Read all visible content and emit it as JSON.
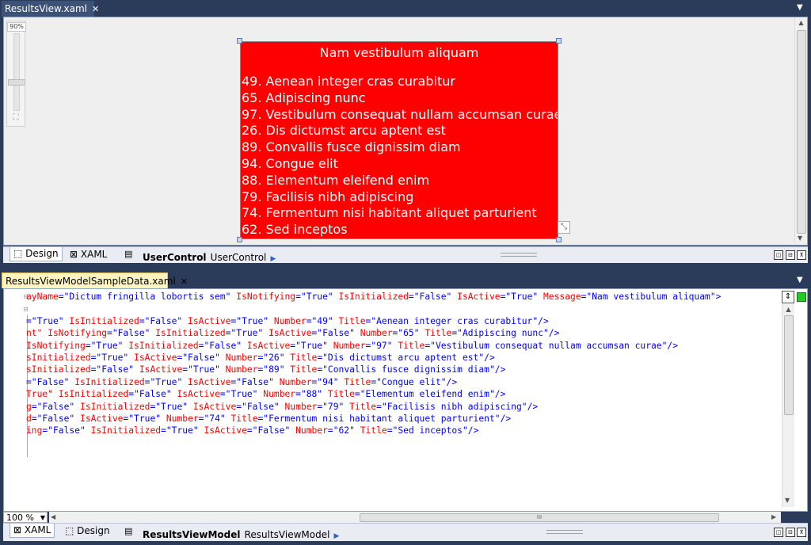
{
  "designer_tab": {
    "label": "ResultsView.xaml",
    "close": "✕"
  },
  "editor_tab": {
    "label": "ResultsViewModelSampleData.xaml",
    "close": "✕"
  },
  "zoom_slider_label": "90%",
  "preview": {
    "title": "Nam vestibulum aliquam",
    "items": [
      "49.  Aenean integer cras curabitur",
      "65.  Adipiscing nunc",
      "97.  Vestibulum consequat nullam accumsan curae",
      "26.  Dis dictumst arcu aptent est",
      "89.  Convallis fusce dignissim diam",
      "94.  Congue elit",
      "88.  Elementum eleifend enim",
      "79.  Facilisis nibh adipiscing",
      "74.  Fermentum nisi habitant aliquet parturient",
      "62.  Sed inceptos"
    ]
  },
  "designer_strip": {
    "design_tab": "Design",
    "xaml_tab": "XAML",
    "breadcrumb_bold": "UserControl",
    "breadcrumb": "UserControl"
  },
  "editor_strip": {
    "xaml_tab": "XAML",
    "design_tab": "Design",
    "breadcrumb_bold": "ResultsViewModel",
    "breadcrumb": "ResultsViewModel",
    "zoom": "100 %"
  },
  "code_lines": [
    [
      [
        "a",
        "ayName"
      ],
      [
        "v",
        "=\"Dictum fringilla lobortis sem\""
      ],
      [
        "a",
        " IsNotifying"
      ],
      [
        "v",
        "=\"True\""
      ],
      [
        "a",
        " IsInitialized"
      ],
      [
        "v",
        "=\"False\""
      ],
      [
        "a",
        " IsActive"
      ],
      [
        "v",
        "=\"True\""
      ],
      [
        "a",
        " Message"
      ],
      [
        "v",
        "=\"Nam vestibulum aliquam\""
      ],
      [
        "v",
        ">"
      ]
    ],
    [],
    [
      [
        "v",
        "=\"True\""
      ],
      [
        "a",
        " IsInitialized"
      ],
      [
        "v",
        "=\"False\""
      ],
      [
        "a",
        " IsActive"
      ],
      [
        "v",
        "=\"True\""
      ],
      [
        "a",
        " Number"
      ],
      [
        "v",
        "=\"49\""
      ],
      [
        "a",
        " Title"
      ],
      [
        "v",
        "=\"Aenean integer cras curabitur\""
      ],
      [
        "v",
        "/>"
      ]
    ],
    [
      [
        "a",
        "nt\""
      ],
      [
        "a",
        " IsNotifying"
      ],
      [
        "v",
        "=\"False\""
      ],
      [
        "a",
        " IsInitialized"
      ],
      [
        "v",
        "=\"True\""
      ],
      [
        "a",
        " IsActive"
      ],
      [
        "v",
        "=\"False\""
      ],
      [
        "a",
        " Number"
      ],
      [
        "v",
        "=\"65\""
      ],
      [
        "a",
        " Title"
      ],
      [
        "v",
        "=\"Adipiscing nunc\""
      ],
      [
        "v",
        "/>"
      ]
    ],
    [
      [
        "a",
        "IsNotifying"
      ],
      [
        "v",
        "=\"True\""
      ],
      [
        "a",
        " IsInitialized"
      ],
      [
        "v",
        "=\"False\""
      ],
      [
        "a",
        " IsActive"
      ],
      [
        "v",
        "=\"True\""
      ],
      [
        "a",
        " Number"
      ],
      [
        "v",
        "=\"97\""
      ],
      [
        "a",
        " Title"
      ],
      [
        "v",
        "=\"Vestibulum consequat nullam accumsan curae\""
      ],
      [
        "v",
        "/>"
      ]
    ],
    [
      [
        "a",
        "sInitialized"
      ],
      [
        "v",
        "=\"True\""
      ],
      [
        "a",
        " IsActive"
      ],
      [
        "v",
        "=\"False\""
      ],
      [
        "a",
        " Number"
      ],
      [
        "v",
        "=\"26\""
      ],
      [
        "a",
        " Title"
      ],
      [
        "v",
        "=\"Dis dictumst arcu aptent est\""
      ],
      [
        "v",
        "/>"
      ]
    ],
    [
      [
        "a",
        "sInitialized"
      ],
      [
        "v",
        "=\"False\""
      ],
      [
        "a",
        " IsActive"
      ],
      [
        "v",
        "=\"True\""
      ],
      [
        "a",
        " Number"
      ],
      [
        "v",
        "=\"89\""
      ],
      [
        "a",
        " Title"
      ],
      [
        "v",
        "=\"Convallis fusce dignissim diam\""
      ],
      [
        "v",
        "/>"
      ]
    ],
    [
      [
        "v",
        "=\"False\""
      ],
      [
        "a",
        " IsInitialized"
      ],
      [
        "v",
        "=\"True\""
      ],
      [
        "a",
        " IsActive"
      ],
      [
        "v",
        "=\"False\""
      ],
      [
        "a",
        " Number"
      ],
      [
        "v",
        "=\"94\""
      ],
      [
        "a",
        " Title"
      ],
      [
        "v",
        "=\"Congue elit\""
      ],
      [
        "v",
        "/>"
      ]
    ],
    [
      [
        "a",
        "True\""
      ],
      [
        "a",
        " IsInitialized"
      ],
      [
        "v",
        "=\"False\""
      ],
      [
        "a",
        " IsActive"
      ],
      [
        "v",
        "=\"True\""
      ],
      [
        "a",
        " Number"
      ],
      [
        "v",
        "=\"88\""
      ],
      [
        "a",
        " Title"
      ],
      [
        "v",
        "=\"Elementum eleifend enim\""
      ],
      [
        "v",
        "/>"
      ]
    ],
    [
      [
        "a",
        "g"
      ],
      [
        "v",
        "=\"False\""
      ],
      [
        "a",
        " IsInitialized"
      ],
      [
        "v",
        "=\"True\""
      ],
      [
        "a",
        " IsActive"
      ],
      [
        "v",
        "=\"False\""
      ],
      [
        "a",
        " Number"
      ],
      [
        "v",
        "=\"79\""
      ],
      [
        "a",
        " Title"
      ],
      [
        "v",
        "=\"Facilisis nibh adipiscing\""
      ],
      [
        "v",
        "/>"
      ]
    ],
    [
      [
        "a",
        "d"
      ],
      [
        "v",
        "=\"False\""
      ],
      [
        "a",
        " IsActive"
      ],
      [
        "v",
        "=\"True\""
      ],
      [
        "a",
        " Number"
      ],
      [
        "v",
        "=\"74\""
      ],
      [
        "a",
        " Title"
      ],
      [
        "v",
        "=\"Fermentum nisi habitant aliquet parturient\""
      ],
      [
        "v",
        "/>"
      ]
    ],
    [
      [
        "a",
        "ing"
      ],
      [
        "v",
        "=\"False\""
      ],
      [
        "a",
        " IsInitialized"
      ],
      [
        "v",
        "=\"True\""
      ],
      [
        "a",
        " IsActive"
      ],
      [
        "v",
        "=\"False\""
      ],
      [
        "a",
        " Number"
      ],
      [
        "v",
        "=\"62\""
      ],
      [
        "a",
        " Title"
      ],
      [
        "v",
        "=\"Sed inceptos\""
      ],
      [
        "v",
        "/>"
      ]
    ]
  ],
  "colors": {
    "preview_bg": "#ff0000",
    "attr": "#ff0000",
    "value": "#0000ff",
    "chrome": "#2b3c5a"
  }
}
